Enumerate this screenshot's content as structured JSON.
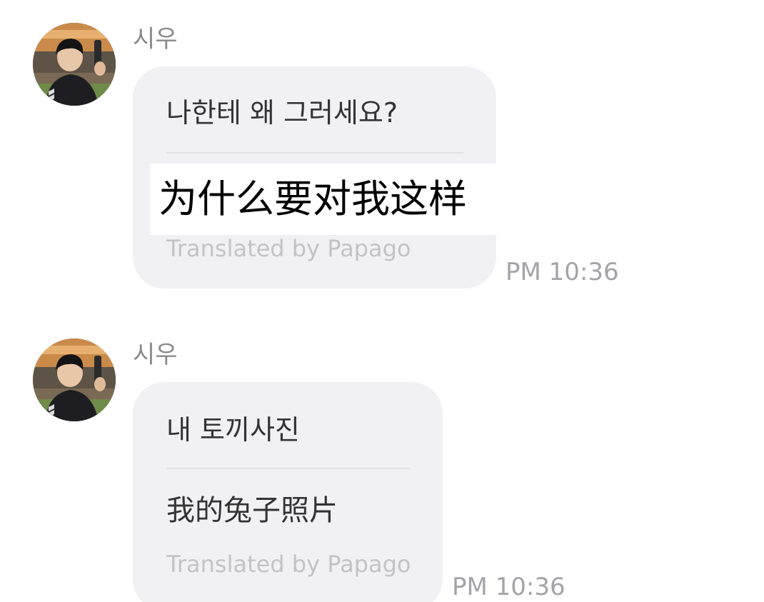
{
  "messages": [
    {
      "sender": "시우",
      "original": "나한테 왜 그러세요?",
      "translation": "为什么要对我这样",
      "credit": "Translated by Papago",
      "time": "PM 10:36"
    },
    {
      "sender": "시우",
      "original": "내 토끼사진",
      "translation": "我的兔子照片",
      "credit": "Translated by Papago",
      "time": "PM 10:36"
    }
  ],
  "colors": {
    "bubble": "#f1f1f3",
    "sender": "#8a8a8a",
    "credit": "#c3c3c7",
    "time": "#a4a4a8"
  }
}
